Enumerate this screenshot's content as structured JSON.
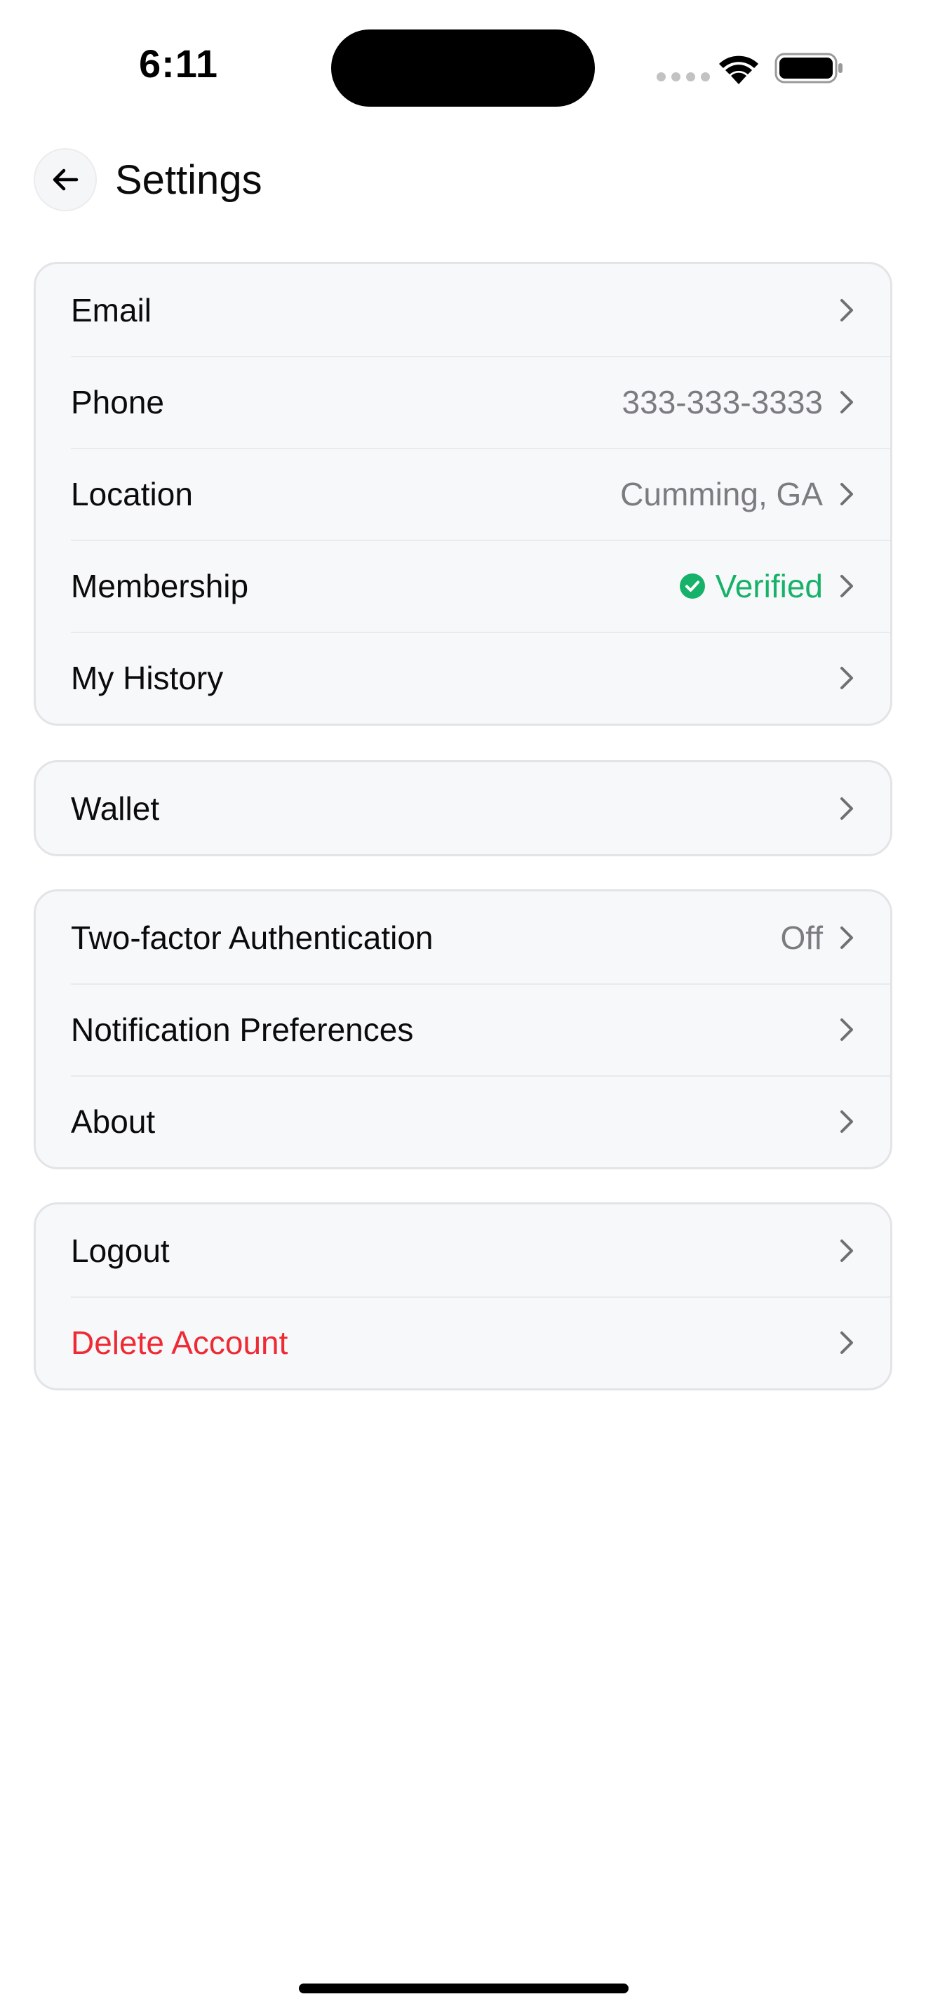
{
  "status_bar": {
    "time": "6:11"
  },
  "header": {
    "back_icon": "arrow-left-icon",
    "title": "Settings"
  },
  "groups": [
    {
      "rows": [
        {
          "label": "Email",
          "value": ""
        },
        {
          "label": "Phone",
          "value": "333-333-3333"
        },
        {
          "label": "Location",
          "value": "Cumming, GA"
        },
        {
          "label": "Membership",
          "value": "Verified",
          "value_icon": "check-circle-icon"
        },
        {
          "label": "My History",
          "value": ""
        }
      ]
    },
    {
      "rows": [
        {
          "label": "Wallet",
          "value": ""
        }
      ]
    },
    {
      "rows": [
        {
          "label": "Two-factor Authentication",
          "value": "Off"
        },
        {
          "label": "Notification Preferences",
          "value": ""
        },
        {
          "label": "About",
          "value": ""
        }
      ]
    },
    {
      "rows": [
        {
          "label": "Logout",
          "value": ""
        },
        {
          "label": "Delete Account",
          "value": ""
        }
      ]
    }
  ],
  "colors": {
    "danger": "#ee2b35",
    "verified": "#17b26a",
    "secondary_text": "#7b7b80",
    "card_background": "#f7f8fa"
  }
}
